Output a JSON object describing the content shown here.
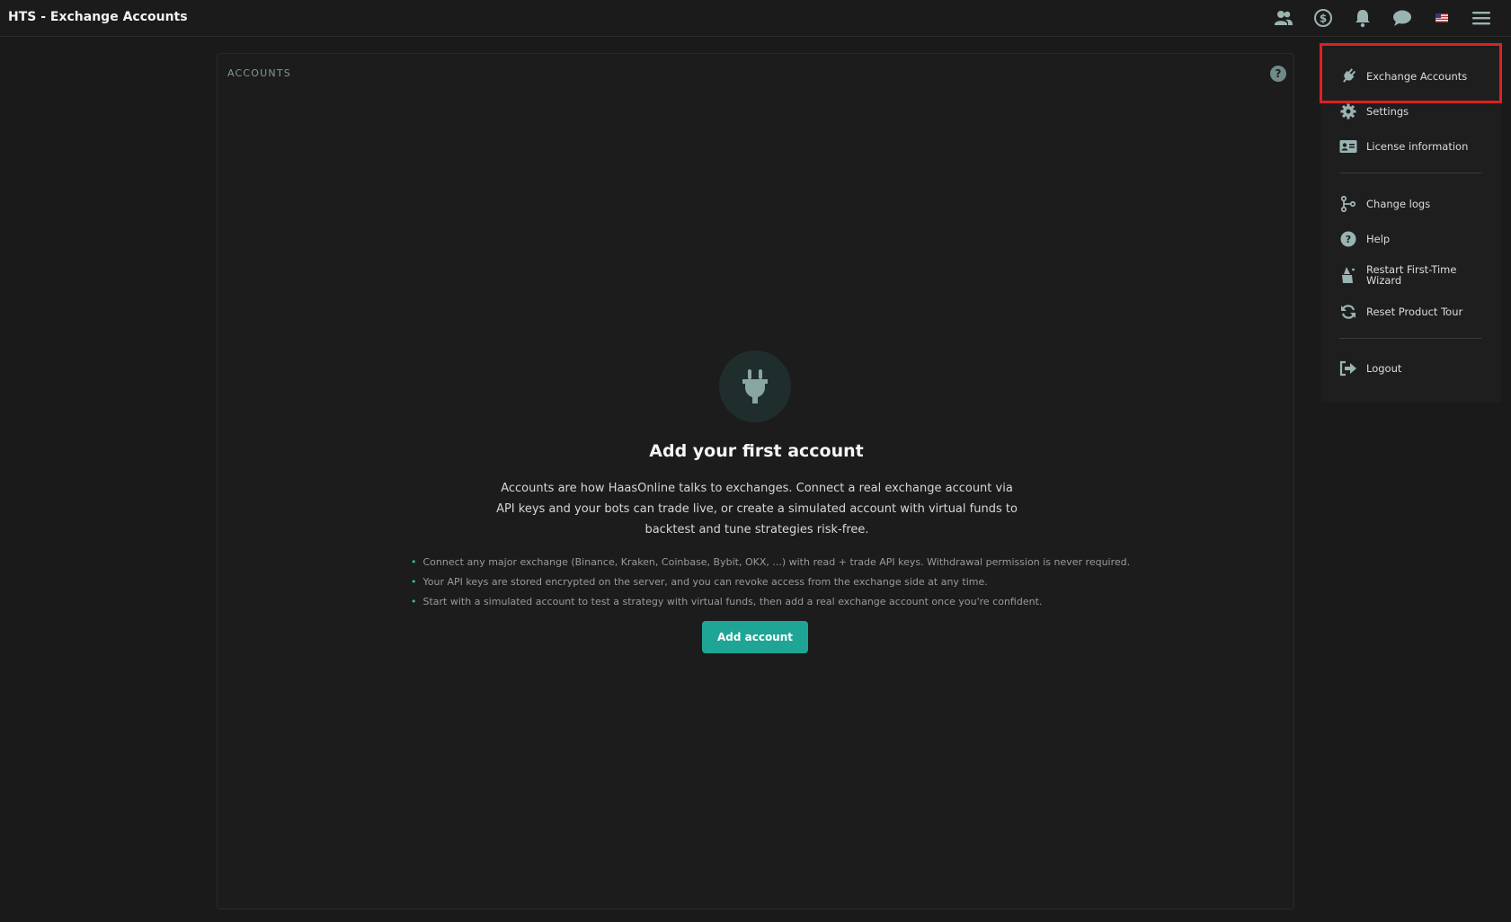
{
  "header": {
    "title": "HTS - Exchange Accounts",
    "icons": [
      "users-icon",
      "dollar-icon",
      "bell-icon",
      "chat-icon",
      "us-flag-icon",
      "hamburger-menu-icon"
    ]
  },
  "card": {
    "title": "ACCOUNTS",
    "help_symbol": "?"
  },
  "empty_state": {
    "icon": "plug-icon",
    "title": "Add your first account",
    "description": "Accounts are how HaasOnline talks to exchanges. Connect a real exchange account via API keys and your bots can trade live, or create a simulated account with virtual funds to backtest and tune strategies risk-free.",
    "bullets": [
      "Connect any major exchange (Binance, Kraken, Coinbase, Bybit, OKX, ...) with read + trade API keys. Withdrawal permission is never required.",
      "Your API keys are stored encrypted on the server, and you can revoke access from the exchange side at any time.",
      "Start with a simulated account to test a strategy with virtual funds, then add a real exchange account once you're confident."
    ],
    "button_label": "Add account"
  },
  "menu": {
    "items": [
      {
        "label": "Exchange Accounts",
        "icon": "plug-icon"
      },
      {
        "label": "Settings",
        "icon": "gear-icon"
      },
      {
        "label": "License information",
        "icon": "id-card-icon"
      },
      {
        "label": "Change logs",
        "icon": "branch-icon"
      },
      {
        "label": "Help",
        "icon": "question-icon"
      },
      {
        "label": "Restart First-Time Wizard",
        "icon": "wizard-icon"
      },
      {
        "label": "Reset Product Tour",
        "icon": "refresh-icon"
      },
      {
        "label": "Logout",
        "icon": "logout-icon"
      }
    ]
  },
  "colors": {
    "accent": "#1fa596",
    "highlight": "#e02020",
    "background": "#1a1a1a"
  }
}
